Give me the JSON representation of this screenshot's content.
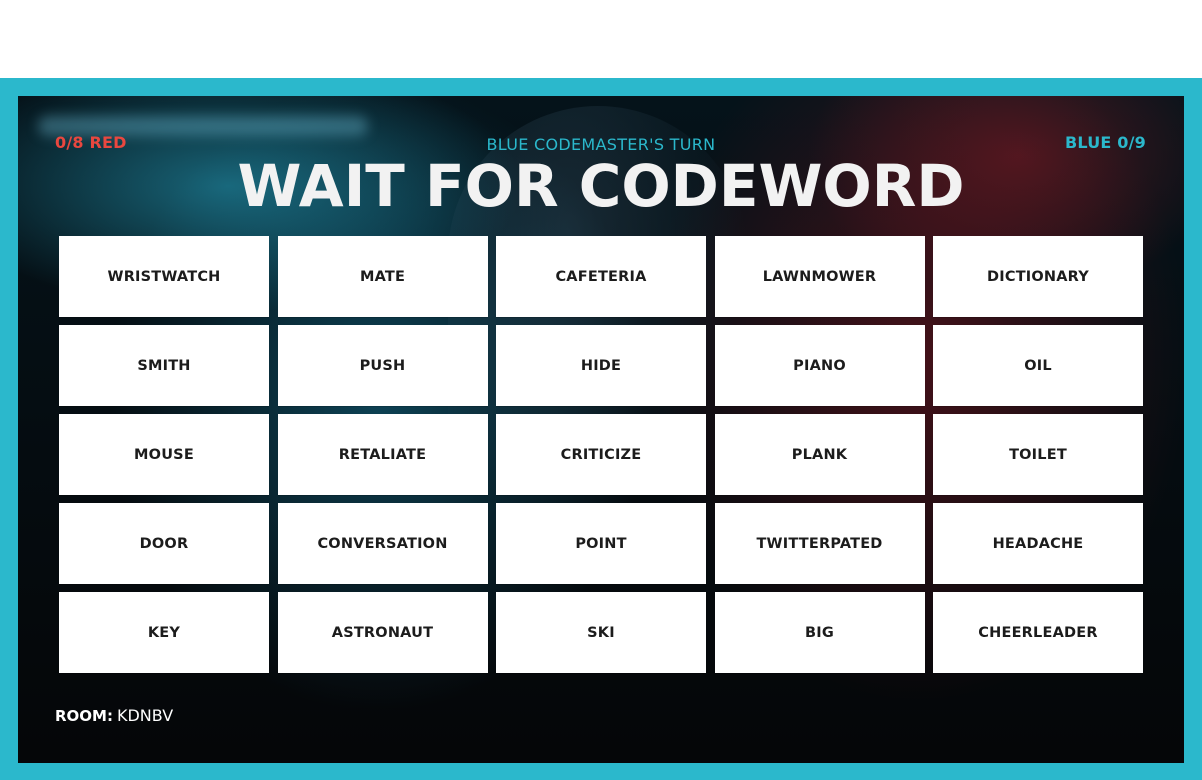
{
  "header": {
    "red_score": "0/8 RED",
    "blue_score": "BLUE 0/9",
    "turn_status": "BLUE CODEMASTER'S TURN",
    "headline": "WAIT FOR CODEWORD"
  },
  "board": {
    "cards": [
      "WRISTWATCH",
      "MATE",
      "CAFETERIA",
      "LAWNMOWER",
      "DICTIONARY",
      "SMITH",
      "PUSH",
      "HIDE",
      "PIANO",
      "OIL",
      "MOUSE",
      "RETALIATE",
      "CRITICIZE",
      "PLANK",
      "TOILET",
      "DOOR",
      "CONVERSATION",
      "POINT",
      "TWITTERPATED",
      "HEADACHE",
      "KEY",
      "ASTRONAUT",
      "SKI",
      "BIG",
      "CHEERLEADER"
    ]
  },
  "footer": {
    "room_label": "ROOM:",
    "room_code": "KDNBV"
  },
  "colors": {
    "red": "#e9473f",
    "blue": "#2bb8cc",
    "card": "#ffffff",
    "card_text": "#1c1c1c"
  }
}
